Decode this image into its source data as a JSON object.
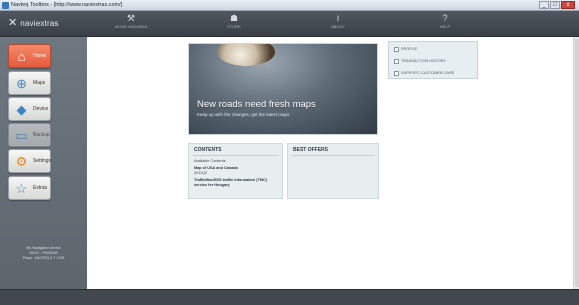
{
  "window": {
    "title": "Navteq Toolbox - [http://www.naviextras.com/]",
    "buttons": [
      "_",
      "□",
      "x"
    ]
  },
  "topbar": {
    "logo_text": "naviextras",
    "nav": [
      {
        "label": "Avoid Hazards",
        "icon": "device-icon"
      },
      {
        "label": "Store",
        "icon": "store-icon"
      },
      {
        "label": "About",
        "icon": "info-icon"
      },
      {
        "label": "Help",
        "icon": "help-icon"
      }
    ]
  },
  "sidebar": {
    "items": [
      {
        "label": "Home",
        "icon": "home-icon",
        "active": true
      },
      {
        "label": "Maps",
        "icon": "maps-icon"
      },
      {
        "label": "Device",
        "icon": "device-icon"
      },
      {
        "label": "Backup",
        "icon": "backup-icon",
        "disabled": true
      },
      {
        "label": "Settings",
        "icon": "settings-icon"
      },
      {
        "label": "Extras",
        "icon": "star-icon"
      }
    ],
    "device_info": [
      "My Navigation device",
      "AVOC - RS08008",
      "Plaza - NAVTEQ 5.7 1708"
    ]
  },
  "hero": {
    "title": "New roads need fresh maps",
    "subtitle": "Keep up with the changes, get the latest maps"
  },
  "links": [
    {
      "label": "Profile"
    },
    {
      "label": "Transaction History"
    },
    {
      "label": "Support, Customer Care"
    }
  ],
  "contents": {
    "title": "CONTENTS",
    "available_label": "Available Contents",
    "items": [
      {
        "name": "Map of USA and Canada",
        "detail": "2011Q2"
      },
      {
        "name": "TrafficMax/SDS traffic information (TMC) service for Hungary",
        "detail": ""
      }
    ]
  },
  "offers": {
    "title": "BEST OFFERS"
  }
}
